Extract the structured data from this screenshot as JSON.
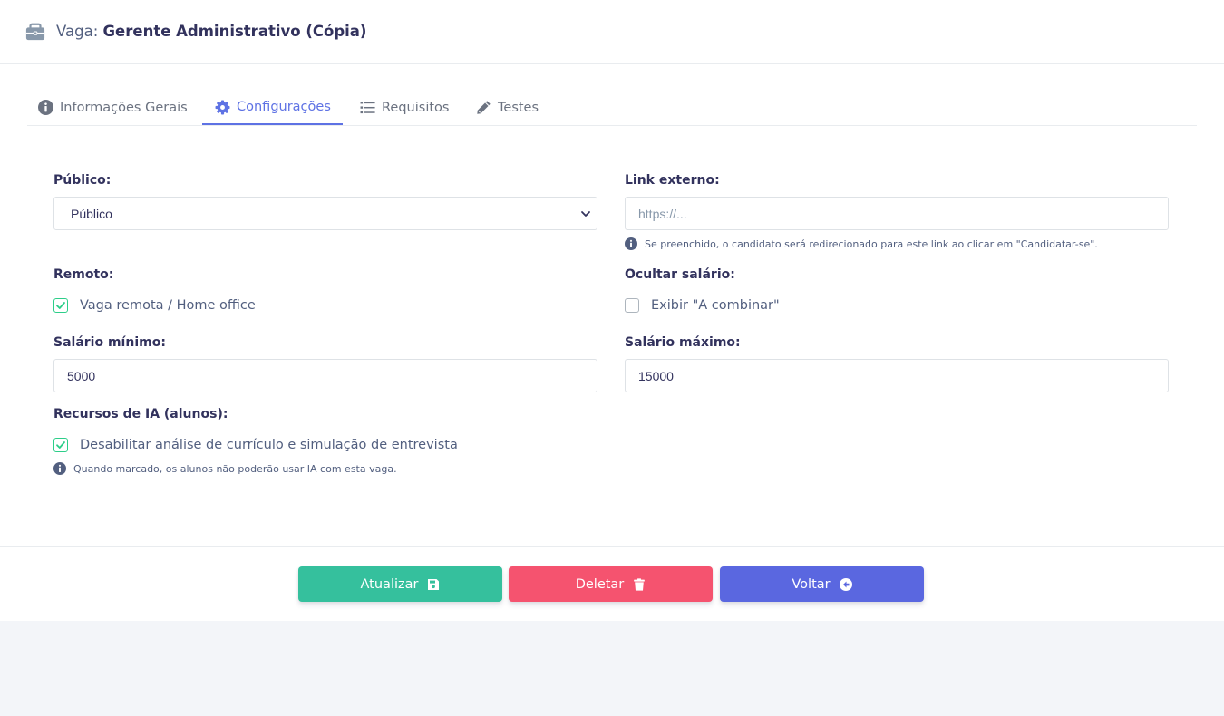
{
  "header": {
    "icon": "briefcase-icon",
    "prefix": "Vaga:",
    "job_title": "Gerente Administrativo (Cópia)"
  },
  "tabs": [
    {
      "label": "Informações Gerais",
      "icon": "info-circle-icon",
      "active": false
    },
    {
      "label": "Configurações",
      "icon": "gear-icon",
      "active": true
    },
    {
      "label": "Requisitos",
      "icon": "list-icon",
      "active": false
    },
    {
      "label": "Testes",
      "icon": "pencil-icon",
      "active": false
    }
  ],
  "form": {
    "publico": {
      "label": "Público:",
      "value": "Público"
    },
    "link_externo": {
      "label": "Link externo:",
      "placeholder": "https://...",
      "help": "Se preenchido, o candidato será redirecionado para este link ao clicar em \"Candidatar-se\"."
    },
    "remoto": {
      "label": "Remoto:",
      "checkbox_label": "Vaga remota / Home office",
      "checked": true
    },
    "ocultar_salario": {
      "label": "Ocultar salário:",
      "checkbox_label": "Exibir \"A combinar\"",
      "checked": false
    },
    "salario_minimo": {
      "label": "Salário mínimo:",
      "value": "5000"
    },
    "salario_maximo": {
      "label": "Salário máximo:",
      "value": "15000"
    },
    "recursos_ia": {
      "label": "Recursos de IA (alunos):",
      "checkbox_label": "Desabilitar análise de currículo e simulação de entrevista",
      "checked": true,
      "help": "Quando marcado, os alunos não poderão usar IA com esta vaga."
    }
  },
  "footer": {
    "update_label": "Atualizar",
    "delete_label": "Deletar",
    "back_label": "Voltar"
  },
  "colors": {
    "accent": "#5e72e4",
    "update": "#35c09d",
    "delete": "#f5536f",
    "back": "#5a67e0",
    "check": "#2dce89"
  }
}
